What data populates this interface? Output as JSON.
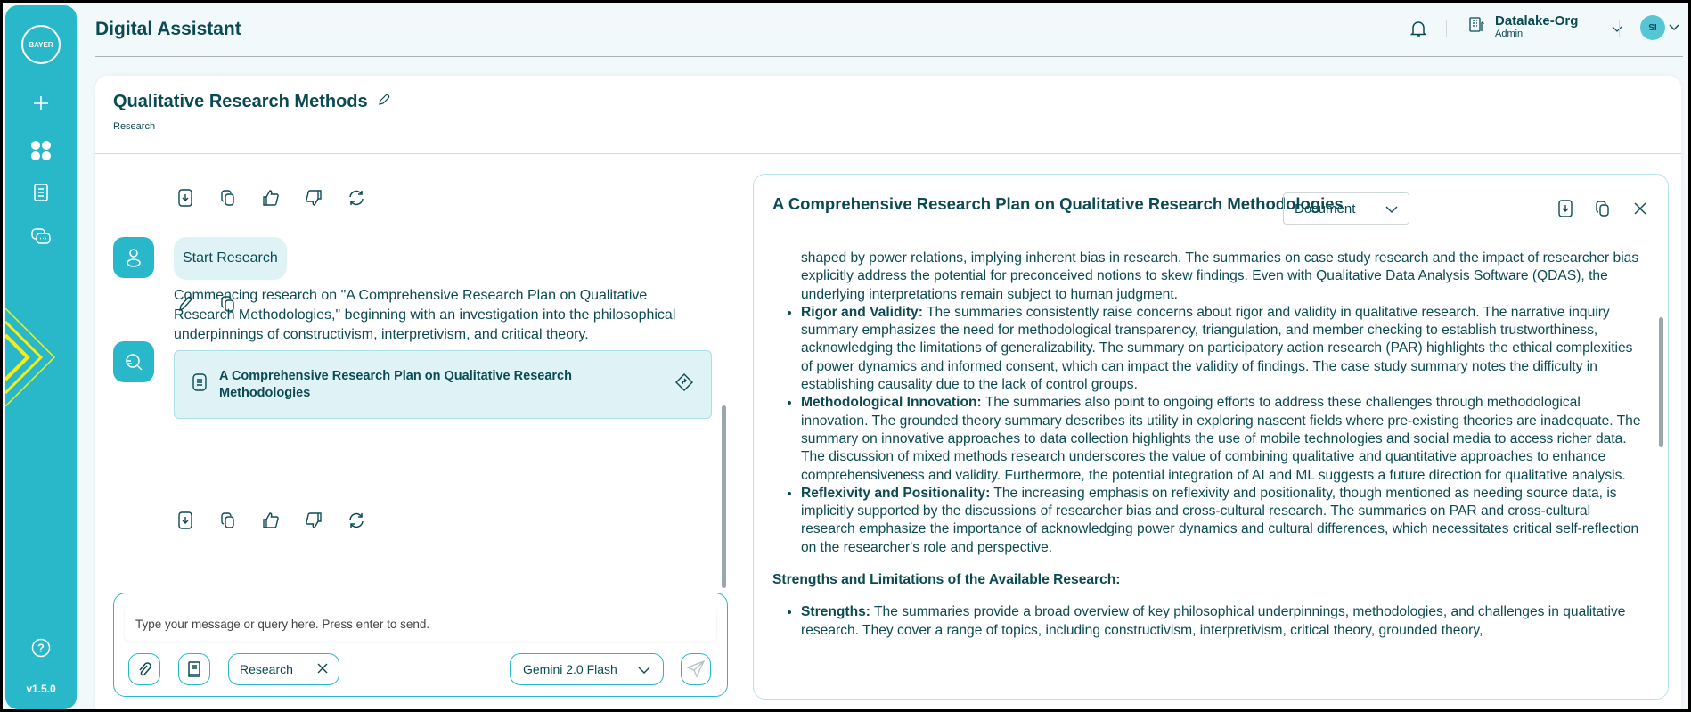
{
  "app": {
    "title": "Digital Assistant",
    "version": "v1.5.0",
    "logo_text": "BAYER",
    "accent": "#29b8c9"
  },
  "sidebar": {
    "items": [
      {
        "icon": "plus-icon"
      },
      {
        "icon": "grid-icon"
      },
      {
        "icon": "notebook-icon"
      },
      {
        "icon": "chat-icon"
      },
      {
        "icon": "help-icon"
      }
    ]
  },
  "header": {
    "org_name": "Datalake-Org",
    "org_role": "Admin",
    "avatar_initials": "SI"
  },
  "conversation": {
    "title": "Qualitative Research Methods",
    "category": "Research"
  },
  "chat": {
    "user_message": "Start Research",
    "assistant_message": "Commencing research on \"A Comprehensive Research Plan on Qualitative Research Methodologies,\" beginning with an investigation into the philosophical underpinnings of constructivism, interpretivism, and critical theory.",
    "doc_card_title": "A Comprehensive Research Plan on Qualitative Research Methodologies"
  },
  "input": {
    "placeholder": "Type your message or query here. Press enter to send.",
    "chip": "Research",
    "model": "Gemini 2.0 Flash"
  },
  "panel": {
    "title": "A Comprehensive Research Plan on Qualitative Research Methodologies",
    "view_select": "Document",
    "items": [
      {
        "bold": "",
        "text": "shaped by power relations, implying inherent bias in research. The summaries on case study research and the impact of researcher bias explicitly address the potential for preconceived notions to skew findings. Even with Qualitative Data Analysis Software (QDAS), the underlying interpretations remain subject to human judgment."
      },
      {
        "bold": "Rigor and Validity:",
        "text": " The summaries consistently raise concerns about rigor and validity in qualitative research. The narrative inquiry summary emphasizes the need for methodological transparency, triangulation, and member checking to establish trustworthiness, acknowledging the limitations of generalizability. The summary on participatory action research (PAR) highlights the ethical complexities of power dynamics and informed consent, which can impact the validity of findings. The case study summary notes the difficulty in establishing causality due to the lack of control groups."
      },
      {
        "bold": "Methodological Innovation:",
        "text": " The summaries also point to ongoing efforts to address these challenges through methodological innovation. The grounded theory summary describes its utility in exploring nascent fields where pre-existing theories are inadequate. The summary on innovative approaches to data collection highlights the use of mobile technologies and social media to access richer data. The discussion of mixed methods research underscores the value of combining qualitative and quantitative approaches to enhance comprehensiveness and validity. Furthermore, the potential integration of AI and ML suggests a future direction for qualitative analysis."
      },
      {
        "bold": "Reflexivity and Positionality:",
        "text": " The increasing emphasis on reflexivity and positionality, though mentioned as needing source data, is implicitly supported by the discussions of researcher bias and cross-cultural research. The summaries on PAR and cross-cultural research emphasize the importance of acknowledging power dynamics and cultural differences, which necessitates critical self-reflection on the researcher's role and perspective."
      }
    ],
    "heading": "Strengths and Limitations of the Available Research:",
    "items2": [
      {
        "bold": "Strengths:",
        "text": " The summaries provide a broad overview of key philosophical underpinnings, methodologies, and challenges in qualitative research. They cover a range of topics, including constructivism, interpretivism, critical theory, grounded theory,"
      }
    ]
  }
}
